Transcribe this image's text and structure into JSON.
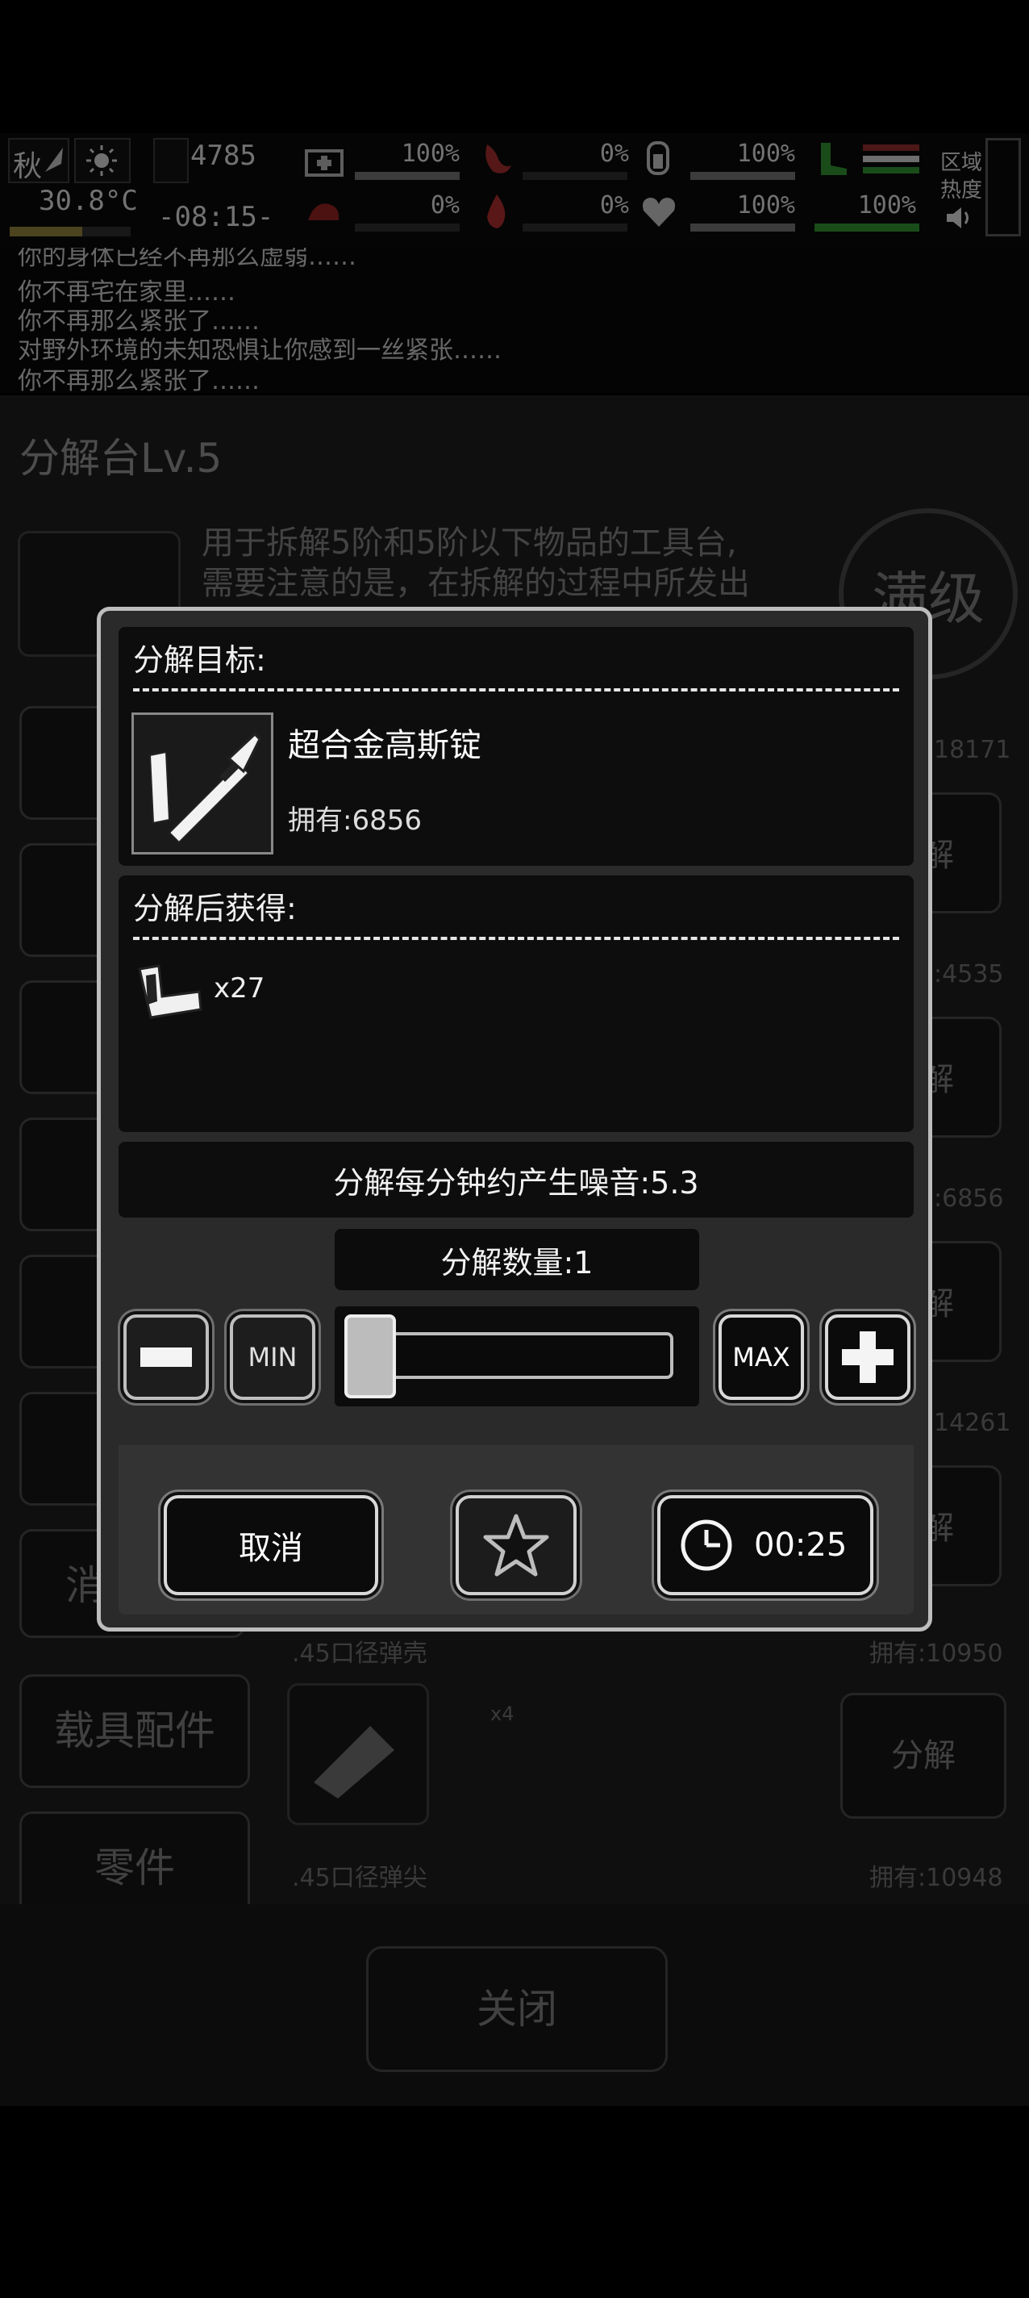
{
  "status": {
    "season": "秋",
    "temperature": "30.8°C",
    "counter": "4785",
    "time": "-08:15-",
    "stats": [
      {
        "name": "health",
        "value": "100%",
        "fill": 1.0
      },
      {
        "name": "hunger",
        "value": "0%",
        "fill": 0.0
      },
      {
        "name": "water",
        "value": "100%",
        "fill": 1.0
      },
      {
        "name": "body",
        "value": "0%",
        "fill": 0.0
      },
      {
        "name": "heat",
        "value": "0%",
        "fill": 0.0
      },
      {
        "name": "mood",
        "value": "100%",
        "fill": 1.0
      },
      {
        "name": "stamina",
        "value": "100%",
        "fill": 1.0
      }
    ],
    "zone_label_1": "区域",
    "zone_label_2": "热度"
  },
  "log": [
    "你的身体已经不再那么虚弱……",
    "你不再宅在家里……",
    "你不再那么紧张了……",
    "对野外环境的未知恐惧让你感到一丝紧张……",
    "你不再那么紧张了……"
  ],
  "background": {
    "title": "分解台Lv.5",
    "description_1": "用于拆解5阶和5阶以下物品的工具台,",
    "description_2": "需要注意的是，在拆解的过程中所发出",
    "max_badge": "满级",
    "counts": [
      "18171",
      ":4535",
      ":6856",
      "14261"
    ],
    "decompose_label": "解",
    "side_tab_partial": "消",
    "side_tabs": [
      "载具配件",
      "零件"
    ],
    "item_1_name": ".45口径弹壳",
    "item_1_owned": "拥有:10950",
    "item_2_name": ".45口径弹尖",
    "item_2_owned": "拥有:10948",
    "item_2_yield": "x4",
    "decompose_button": "分解",
    "close_button": "关闭"
  },
  "dialog": {
    "target_header": "分解目标:",
    "item_name": "超合金高斯锭",
    "item_owned": "拥有:6856",
    "result_header": "分解后获得:",
    "result_qty": "x27",
    "noise": "分解每分钟约产生噪音:5.3",
    "quantity_label": "分解数量:1",
    "quantity": 1,
    "min_label": "MIN",
    "max_label": "MAX",
    "cancel_label": "取消",
    "timer_label": "00:25"
  },
  "colors": {
    "accent": "#d8d8d8",
    "panel": "#0d0d0d",
    "dialog_bg": "#2a2a2a"
  }
}
